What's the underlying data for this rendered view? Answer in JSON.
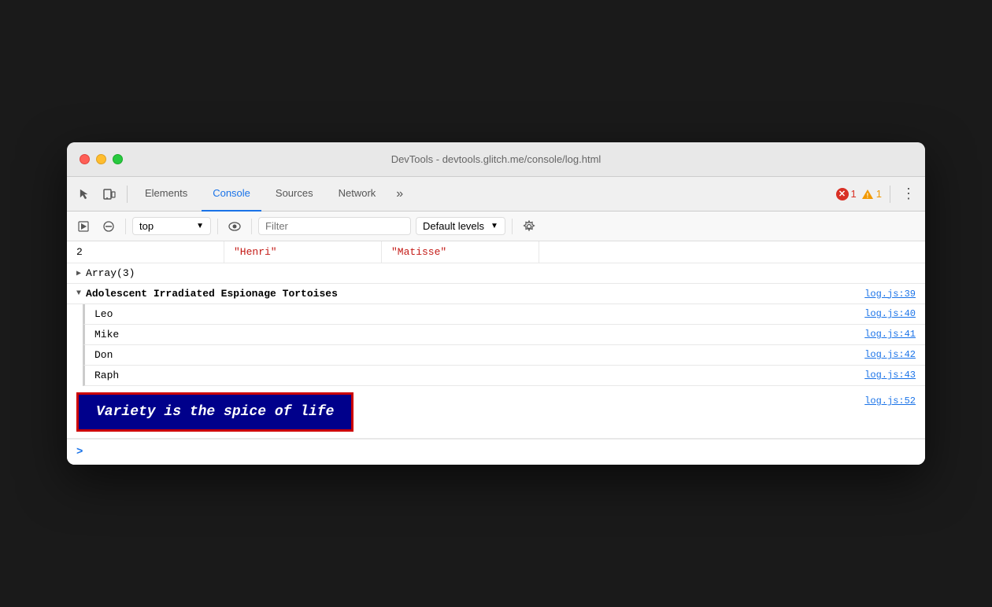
{
  "window": {
    "title": "DevTools - devtools.glitch.me/console/log.html"
  },
  "tabs": [
    {
      "id": "elements",
      "label": "Elements",
      "active": false
    },
    {
      "id": "console",
      "label": "Console",
      "active": true
    },
    {
      "id": "sources",
      "label": "Sources",
      "active": false
    },
    {
      "id": "network",
      "label": "Network",
      "active": false
    }
  ],
  "more_tabs_label": "»",
  "error_badge": "1",
  "warn_badge": "1",
  "kebab_label": "⋮",
  "secondary_toolbar": {
    "context": "top",
    "filter_placeholder": "Filter",
    "levels_label": "Default levels"
  },
  "table": {
    "row": {
      "index": "2",
      "col2": "\"Henri\"",
      "col3": "\"Matisse\""
    }
  },
  "array_row": {
    "label": "Array(3)"
  },
  "group": {
    "label": "Adolescent Irradiated Espionage Tortoises",
    "link": "log.js:39",
    "items": [
      {
        "name": "Leo",
        "link": "log.js:40"
      },
      {
        "name": "Mike",
        "link": "log.js:41"
      },
      {
        "name": "Don",
        "link": "log.js:42"
      },
      {
        "name": "Raph",
        "link": "log.js:43"
      }
    ]
  },
  "styled_log": {
    "message": "Variety is the spice of life",
    "link": "log.js:52"
  },
  "console_input": {
    "prompt": ">"
  }
}
